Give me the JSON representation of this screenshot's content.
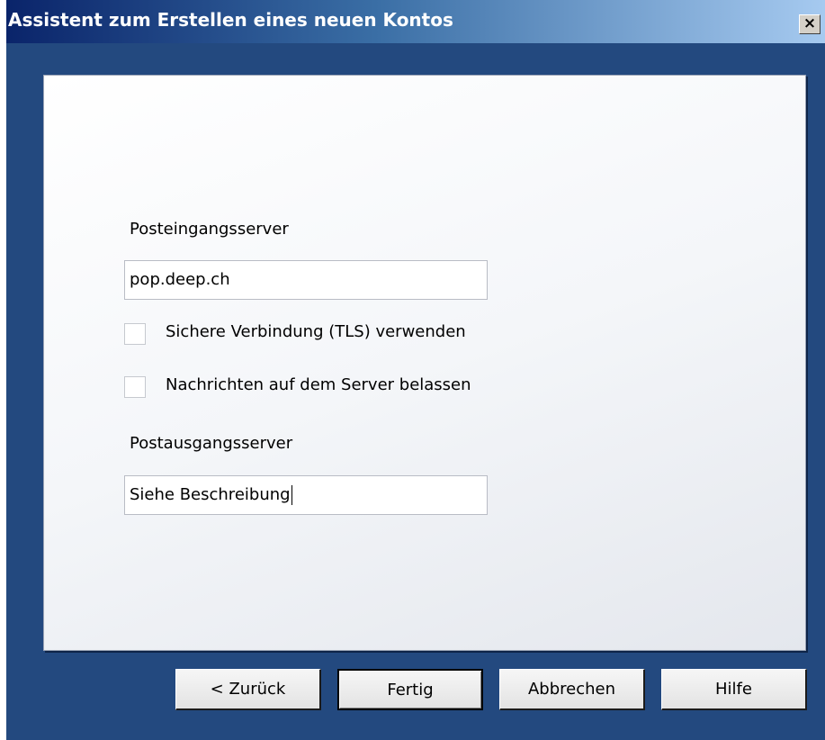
{
  "window": {
    "title": "Assistent zum Erstellen eines neuen Kontos",
    "close_symbol": "×"
  },
  "form": {
    "incoming_label": "Posteingangsserver",
    "incoming_value": "pop.deep.ch",
    "tls_checkbox_label": "Sichere Verbindung (TLS) verwenden",
    "tls_checked": false,
    "keep_messages_label": "Nachrichten auf dem Server belassen",
    "keep_messages_checked": false,
    "outgoing_label": "Postausgangsserver",
    "outgoing_value": "Siehe Beschreibung"
  },
  "buttons": {
    "back": "< Zurück",
    "finish": "Fertig",
    "cancel": "Abbrechen",
    "help": "Hilfe"
  },
  "icons": {
    "close": "close-icon"
  }
}
